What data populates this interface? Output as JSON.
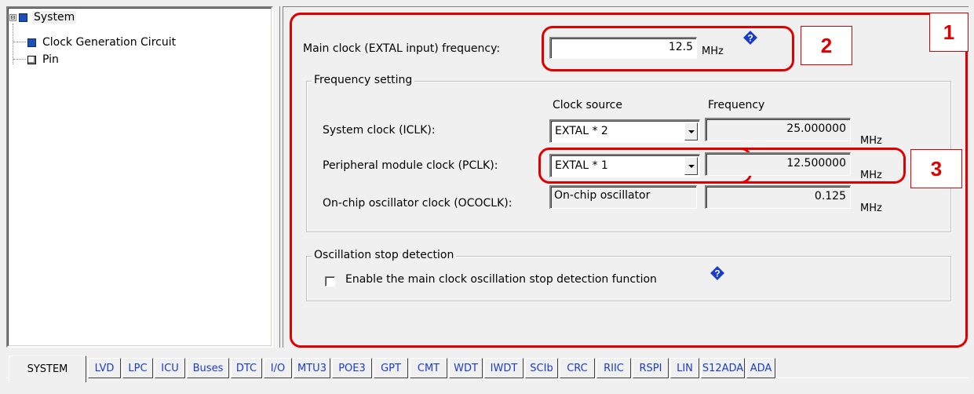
{
  "tree": {
    "root": {
      "label": "System",
      "expander": "⊟"
    },
    "children": [
      {
        "label": "Clock Generation Circuit",
        "icon": "blue-square-icon"
      },
      {
        "label": "Pin",
        "icon": "pin-square-icon"
      }
    ]
  },
  "callouts": {
    "one": "1",
    "two": "2",
    "three": "3"
  },
  "main_clock": {
    "label": "Main clock (EXTAL input) frequency:",
    "value": "12.5",
    "unit": "MHz"
  },
  "frequency_setting": {
    "group_label": "Frequency setting",
    "col_clock_source": "Clock source",
    "col_frequency": "Frequency",
    "rows": [
      {
        "label": "System clock (ICLK):",
        "source": "EXTAL * 2",
        "frequency": "25.000000",
        "unit": "MHz"
      },
      {
        "label": "Peripheral module clock (PCLK):",
        "source": "EXTAL * 1",
        "frequency": "12.500000",
        "unit": "MHz"
      },
      {
        "label": "On-chip oscillator clock (OCOCLK):",
        "source": "On-chip oscillator",
        "frequency": "0.125",
        "unit": "MHz"
      }
    ]
  },
  "oscillation_stop": {
    "group_label": "Oscillation stop detection",
    "checkbox_label": "Enable the main clock oscillation stop detection function",
    "checked": false
  },
  "tabs": [
    {
      "label": "SYSTEM",
      "active": true
    },
    {
      "label": "LVD"
    },
    {
      "label": "LPC"
    },
    {
      "label": "ICU"
    },
    {
      "label": "Buses"
    },
    {
      "label": "DTC"
    },
    {
      "label": "I/O"
    },
    {
      "label": "MTU3"
    },
    {
      "label": "POE3"
    },
    {
      "label": "GPT"
    },
    {
      "label": "CMT"
    },
    {
      "label": "WDT"
    },
    {
      "label": "IWDT"
    },
    {
      "label": "SCIb"
    },
    {
      "label": "CRC"
    },
    {
      "label": "RIIC"
    },
    {
      "label": "RSPI"
    },
    {
      "label": "LIN"
    },
    {
      "label": "S12ADA"
    },
    {
      "label": "ADA"
    }
  ],
  "colors": {
    "callout": "#e00000",
    "tab_text": "#1a3cc8",
    "tree_icon": "#1e4fb5",
    "help_icon": "#1a3cc8"
  }
}
